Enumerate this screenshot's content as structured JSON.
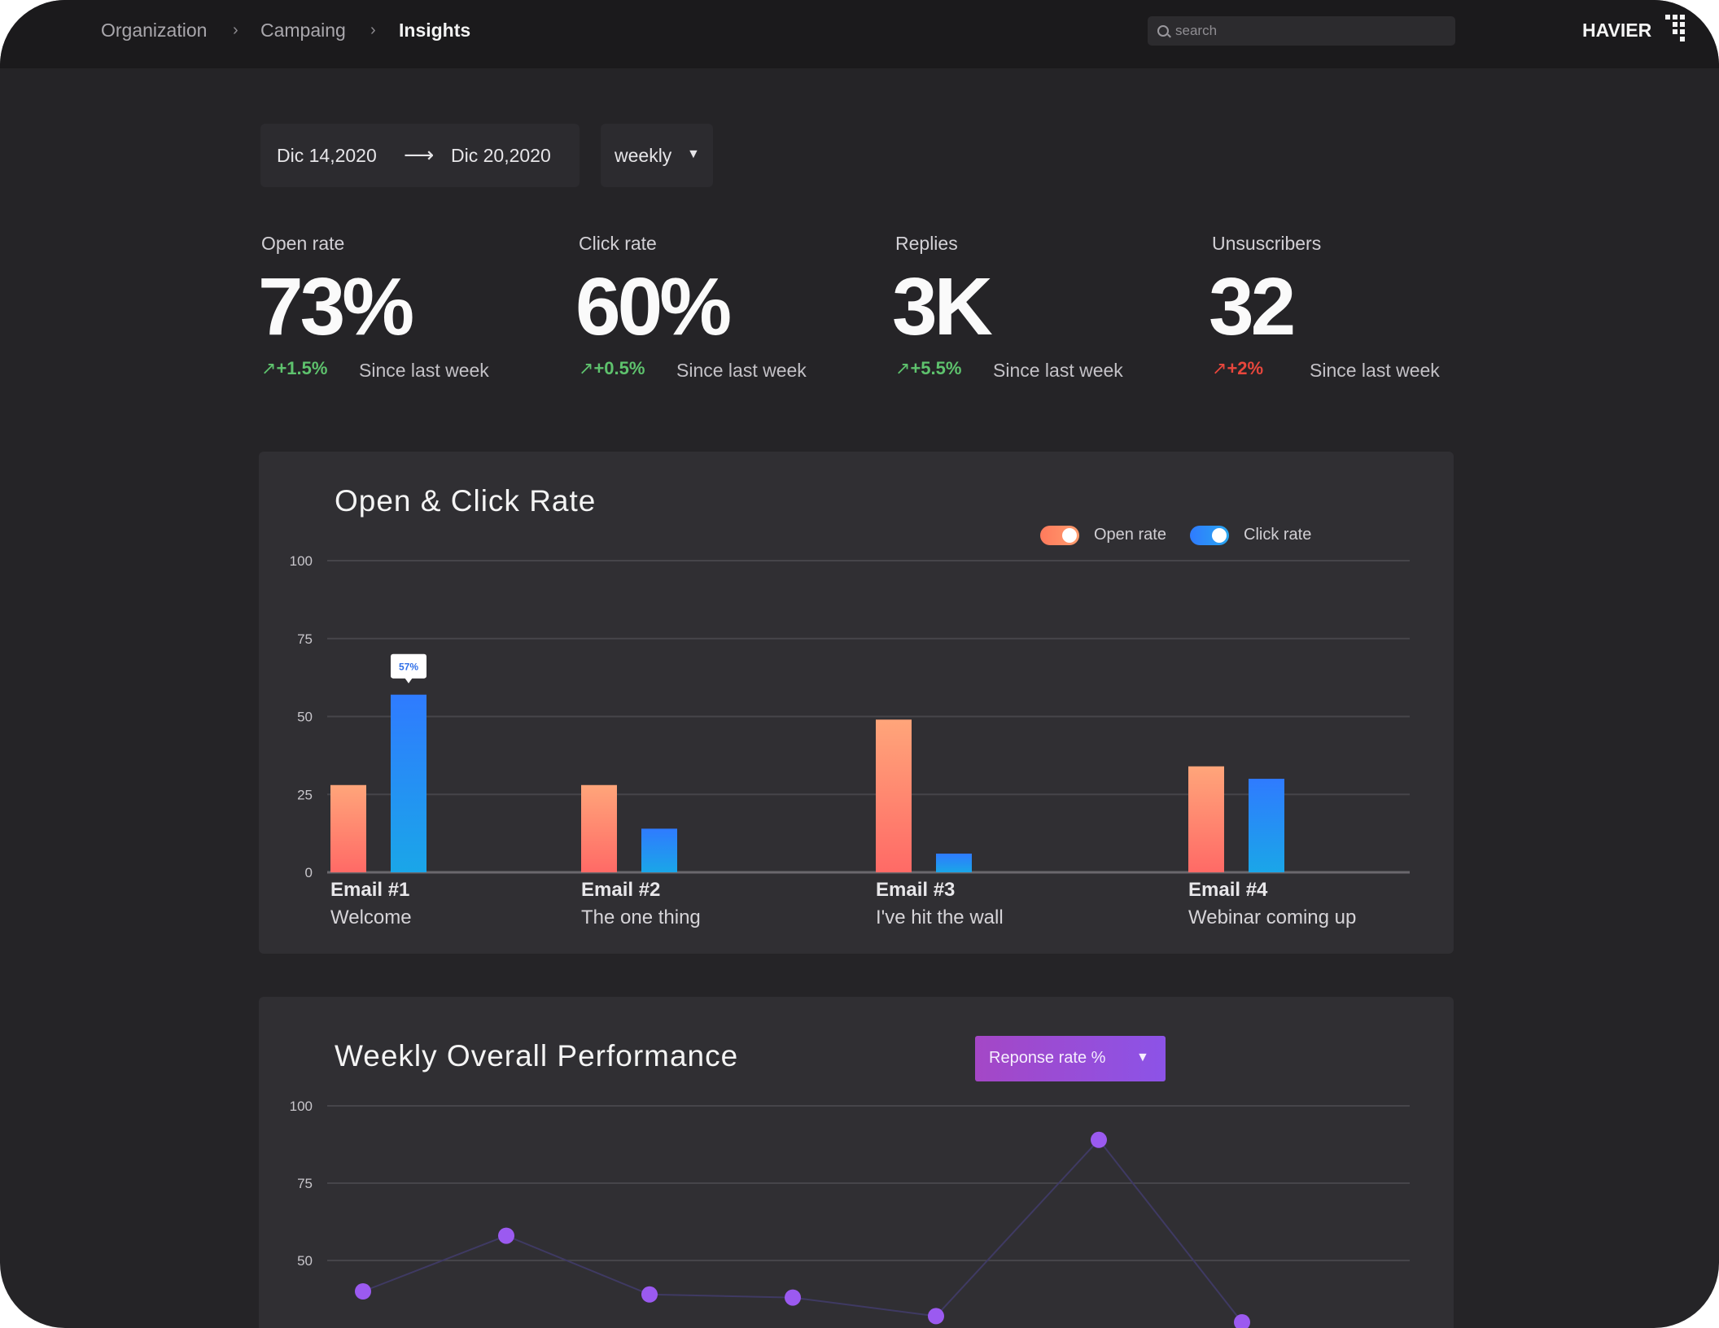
{
  "breadcrumb": {
    "items": [
      "Organization",
      "Campaing",
      "Insights"
    ],
    "separator": "›"
  },
  "search": {
    "placeholder": "search"
  },
  "brand": {
    "name": "HAVIER"
  },
  "filters": {
    "date_start": "Dic 14,2020",
    "date_end": "Dic 20,2020",
    "period": "weekly"
  },
  "stats": [
    {
      "label": "Open rate",
      "value": "73%",
      "delta": "+1.5%",
      "trend": "up",
      "color": "#5ec26d",
      "since": "Since last week"
    },
    {
      "label": "Click rate",
      "value": "60%",
      "delta": "+0.5%",
      "trend": "up",
      "color": "#5ec26d",
      "since": "Since last week"
    },
    {
      "label": "Replies",
      "value": "3K",
      "delta": "+5.5%",
      "trend": "up",
      "color": "#5ec26d",
      "since": "Since last week"
    },
    {
      "label": "Unsuscribers",
      "value": "32",
      "delta": "+2%",
      "trend": "up",
      "color": "#e8463c",
      "since": "Since last week"
    }
  ],
  "chart_open_click": {
    "title": "Open & Click Rate",
    "legend": {
      "open_label": "Open rate",
      "click_label": "Click rate",
      "open_on": true,
      "click_on": true
    }
  },
  "chart_weekly": {
    "title": "Weekly Overall Performance",
    "metric_select": "Reponse rate %"
  },
  "colors": {
    "open_bar_top": "#ffa57a",
    "open_bar_bottom": "#ff6a66",
    "click_bar_top": "#2f7bff",
    "click_bar_bottom": "#1aa6e8",
    "line_point": "#9b5af0"
  },
  "chart_data": [
    {
      "type": "bar",
      "title": "Open & Click Rate",
      "categories": [
        "Email #1",
        "Email #2",
        "Email #3",
        "Email #4"
      ],
      "category_subtitles": [
        "Welcome",
        "The one thing",
        "I've hit the wall",
        "Webinar coming up"
      ],
      "series": [
        {
          "name": "Open rate",
          "values": [
            28,
            28,
            49,
            34
          ]
        },
        {
          "name": "Click rate",
          "values": [
            57,
            14,
            6,
            30
          ]
        }
      ],
      "ylim": [
        0,
        100
      ],
      "yticks": [
        0,
        25,
        50,
        75,
        100
      ],
      "data_labels": [
        {
          "series": "Click rate",
          "category": "Email #1",
          "text": "57%"
        }
      ],
      "grid": true,
      "legend": "top-right"
    },
    {
      "type": "line",
      "title": "Weekly Overall Performance",
      "x": [
        1,
        2,
        3,
        4,
        5,
        6,
        7
      ],
      "series": [
        {
          "values": [
            40,
            58,
            39,
            38,
            32,
            89,
            30
          ]
        }
      ],
      "ylim": [
        0,
        100
      ],
      "yticks": [
        50,
        75,
        100
      ],
      "grid": true
    }
  ]
}
